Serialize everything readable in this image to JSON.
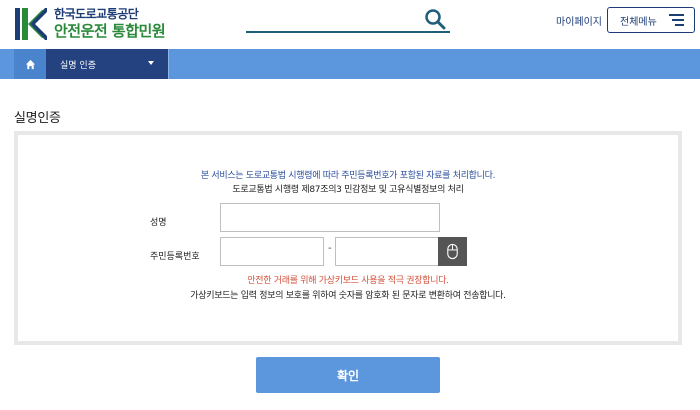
{
  "header": {
    "org_name": "한국도로교통공단",
    "service_name": "안전운전 통합민원",
    "search": {
      "value": "",
      "placeholder": ""
    },
    "mypage_label": "마이페이지",
    "allmenu_label": "전체메뉴"
  },
  "nav": {
    "current_label": "실명 인증"
  },
  "page": {
    "title": "실명인증"
  },
  "form": {
    "notice_line1": "본 서비스는 도로교통법 시행령에 따라 주민등록번호가 포함된 자료를 처리합니다.",
    "notice_line2": "도로교통법 시행령 제87조의3 민감정보 및 고유식별정보의 처리",
    "name_label": "성명",
    "name_value": "",
    "rrn_label": "주민등록번호",
    "rrn_first": "",
    "rrn_dash": "-",
    "rrn_second": "",
    "warning_text": "안전한 거래를 위해 가상키보드 사용을 적극 권장합니다.",
    "info_text": "가상키보드는 입력 정보의 보호를 위하여 숫자를 암호화 된 문자로 변환하여 전송합니다.",
    "confirm_label": "확인"
  },
  "colors": {
    "brand_navy": "#1d3d77",
    "brand_green": "#2a8a3a",
    "nav_blue": "#5c96dc",
    "nav_dark": "#23427f",
    "warning_red": "#d4503a"
  }
}
